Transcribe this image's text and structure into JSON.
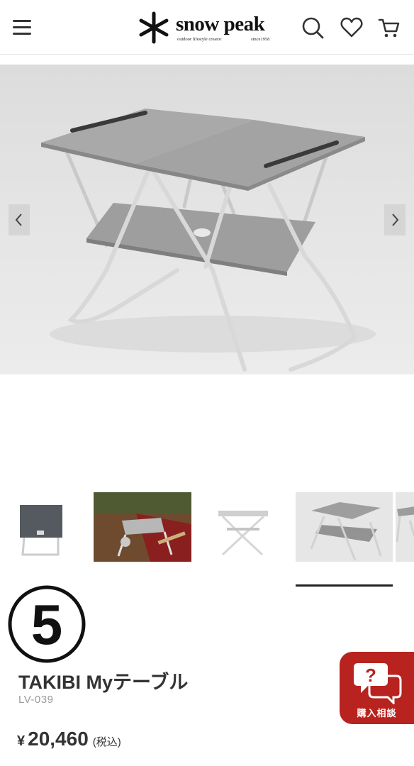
{
  "header": {
    "logo_text": "snow peak",
    "logo_tagline": "outdoor lifestyle creator",
    "logo_since": "since1958",
    "icons": [
      "menu-icon",
      "search-icon",
      "heart-icon",
      "cart-icon"
    ]
  },
  "gallery": {
    "prev_icon": "chevron-left-icon",
    "next_icon": "chevron-right-icon",
    "thumbnail_count": 5,
    "active_thumbnail_index": 3
  },
  "badge": {
    "text": "⑤"
  },
  "product": {
    "name": "TAKIBI Myテーブル",
    "code": "LV-039",
    "price_currency": "¥",
    "price": "20,460",
    "price_tax": "(税込)"
  },
  "chat_button": {
    "label": "購入相談",
    "icon": "question-chat-icon"
  },
  "colors": {
    "accent": "#b8231f",
    "text": "#333333",
    "muted": "#9a9a9a"
  }
}
